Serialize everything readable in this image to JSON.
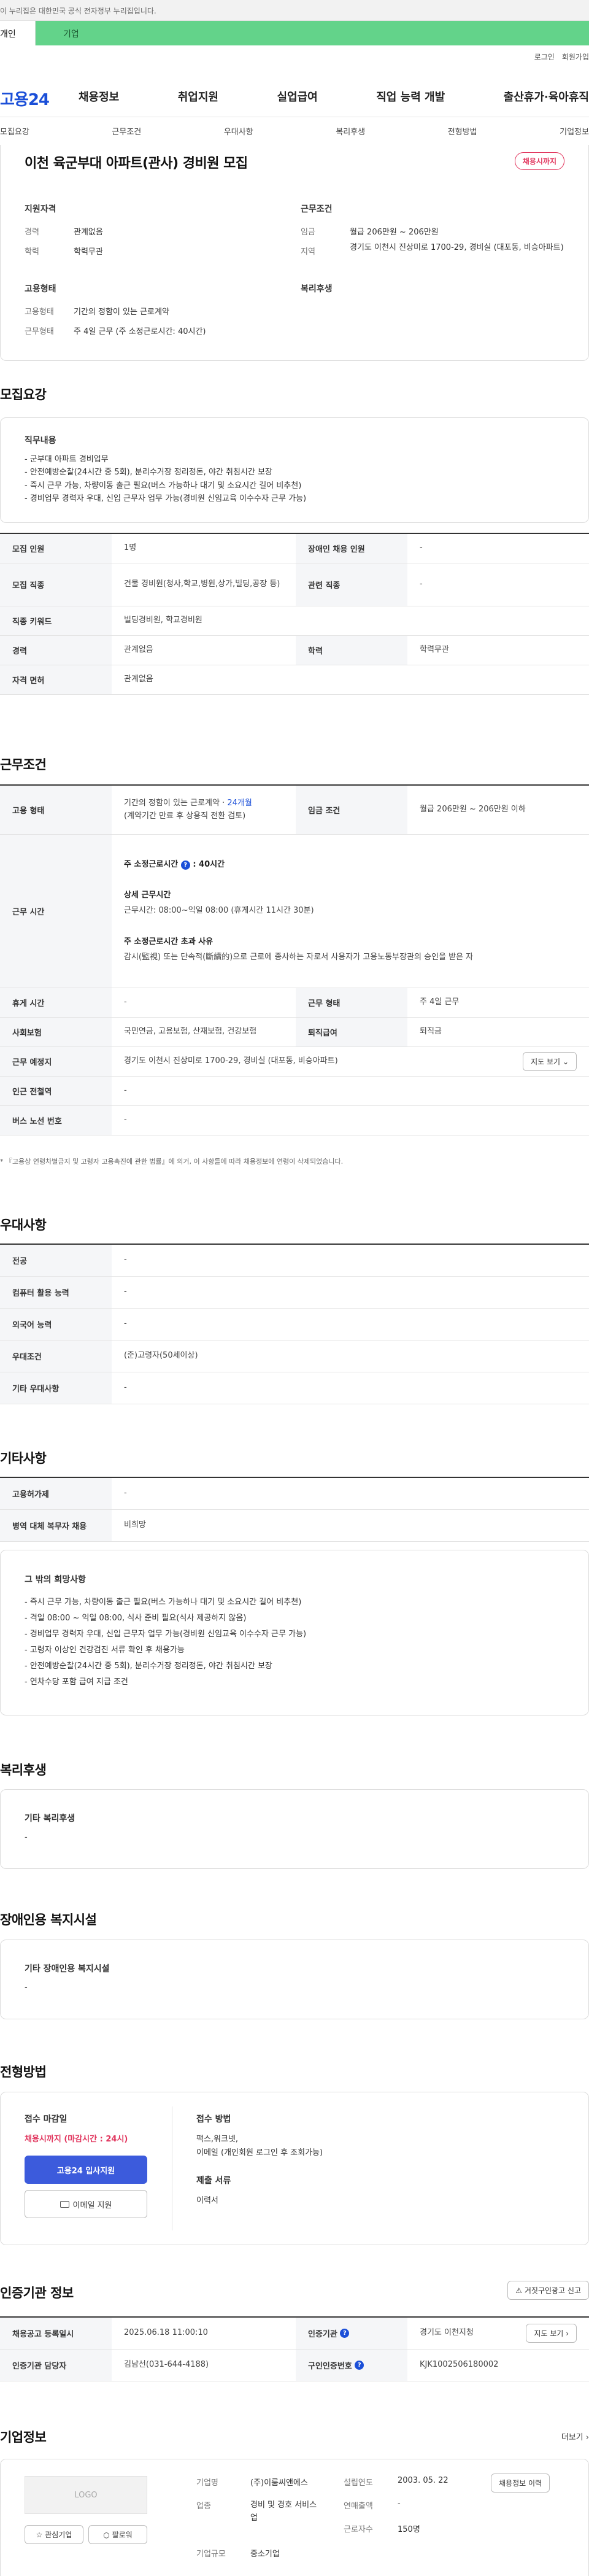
{
  "gov_notice": "이 누리집은 대한민국 공식 전자정부 누리집입니다.",
  "type_tabs": [
    "개인",
    "기업"
  ],
  "util_links": [
    "로그인",
    "회원가입"
  ],
  "logo": "고용24",
  "gnb": [
    "채용정보",
    "취업지원",
    "실업급여",
    "직업 능력 개발",
    "출산휴가·육아휴직"
  ],
  "subnav": [
    "모집요강",
    "근무조건",
    "우대사항",
    "복리후생",
    "전형방법",
    "기업정보"
  ],
  "job": {
    "title": "이천 육군부대 아파트(관사) 경비원 모집",
    "badge": "채용시까지"
  },
  "summary": {
    "qual_h": "지원자격",
    "career_l": "경력",
    "career_v": "관계없음",
    "edu_l": "학력",
    "edu_v": "학력무관",
    "cond_h": "근무조건",
    "wage_l": "임금",
    "wage_v": "월급 206만원 ~ 206만원",
    "loc_l": "지역",
    "loc_v": "경기도 이천시 진상미로 1700-29, 경비실 (대포동, 비승아파트)",
    "emp_h": "고용형태",
    "emp_l": "고용형태",
    "emp_v": "기간의 정함이 있는 근로계약",
    "work_l": "근무형태",
    "work_v": "주 4일 근무 (주 소정근로시간: 40시간)",
    "benefit_h": "복리후생"
  },
  "recruit": {
    "h2": "모집요강",
    "duty_h": "직무내용",
    "duty_lines": [
      "- 군부대 아파트 경비업무",
      "- 안전예방순찰(24시간 중 5회), 분리수거장 정리정돈, 야간 취침시간 보장",
      "- 즉시 근무 가능, 차량이동 출근 필요(버스 가능하나 대기 및 소요시간 길어 비추천)",
      "- 경비업무 경력자 우대, 신입 근무자 업무 가능(경비원 신임교육 이수수자 근무 가능)"
    ],
    "rows": [
      {
        "l1": "모집 인원",
        "v1": "1명",
        "l2": "장애인 채용 인원",
        "v2": "-"
      },
      {
        "l1": "모집 직종",
        "v1": "건물 경비원(청사,학교,병원,상가,빌딩,공장 등)",
        "l2": "관련 직종",
        "v2": "-"
      },
      {
        "l1": "직종 키워드",
        "v1": "빌딩경비원, 학교경비원"
      },
      {
        "l1": "경력",
        "v1": "관계없음",
        "l2": "학력",
        "v2": "학력무관"
      },
      {
        "l1": "자격 면허",
        "v1": "관계없음"
      }
    ]
  },
  "conditions": {
    "h2": "근무조건",
    "emp_l": "고용 형태",
    "emp_v": "기간의 정함이 있는 근로계약 · ",
    "emp_period": "24개월",
    "emp_note": "(계약기간 만료 후 상용직 전환 검토)",
    "wage_l": "임금 조건",
    "wage_v": "월급 206만원 ~ 206만원 이하",
    "time_l": "근무 시간",
    "time_week": "주 소정근로시간",
    "time_week_v": ": 40시간",
    "time_detail_h": "상세 근무시간",
    "time_detail_v": "근무시간: 08:00~익일 08:00 (휴게시간 11시간 30분)",
    "time_exceed_h": "주 소정근로시간 초과 사유",
    "time_exceed_v": "감시(監視) 또는 단속적(斷續的)으로 근로에 종사하는 자로서 사용자가 고용노동부장관의 승인을 받은 자",
    "rest_l": "휴게 시간",
    "rest_v": "-",
    "form_l": "근무 형태",
    "form_v": "주 4일 근무",
    "ins_l": "사회보험",
    "ins_v": "국민연금, 고용보험, 산재보험, 건강보험",
    "sev_l": "퇴직급여",
    "sev_v": "퇴직금",
    "place_l": "근무 예정지",
    "place_v": "경기도 이천시 진상미로 1700-29, 경비실 (대포동, 비승아파트)",
    "map_btn": "지도 보기",
    "subway_l": "인근 전철역",
    "subway_v": "-",
    "bus_l": "버스 노선 번호",
    "bus_v": "-",
    "footnote": "* 『고용상 연령차별금지 및 고령자 고용촉진에 관한 법률』에 의거, 이 사항들에 따라 채용정보에 연령이 삭제되었습니다."
  },
  "pref": {
    "h2": "우대사항",
    "rows": [
      {
        "l": "전공",
        "v": "-"
      },
      {
        "l": "컴퓨터 활용 능력",
        "v": "-"
      },
      {
        "l": "외국어 능력",
        "v": "-"
      },
      {
        "l": "우대조건",
        "v": "(준)고령자(50세이상)"
      },
      {
        "l": "기타 우대사항",
        "v": "-"
      }
    ]
  },
  "etc": {
    "h2": "기타사항",
    "rows": [
      {
        "l": "고용허가제",
        "v": "-"
      },
      {
        "l": "병역 대체 복무자 채용",
        "v": "비희망"
      }
    ],
    "box_h": "그 밖의 희망사항",
    "box_lines": [
      "- 즉시 근무 가능, 차량이동 출근 필요(버스 가능하나 대기 및 소요시간 길어 비추천)",
      "- 격일 08:00 ~ 익일 08:00, 식사 준비 필요(식사 제공하지 않음)",
      "- 경비업무 경력자 우대, 신입 근무자 업무 가능(경비원 신임교육 이수수자 근무 가능)",
      "- 고령자 이상인 건강검진 서류 확인 후 채용가능",
      "- 안전예방순찰(24시간 중 5회), 분리수거장 정리정돈, 야간 취침시간 보장",
      "- 연차수당 포함 급여 지급 조건"
    ]
  },
  "welfare": {
    "h2": "복리후생",
    "box_h": "기타 복리후생",
    "box_v": "-"
  },
  "disabled": {
    "h2": "장애인용 복지시설",
    "box_h": "기타 장애인용 복지시설",
    "box_v": "-"
  },
  "process": {
    "h2": "전형방법",
    "deadline_h": "접수 마감일",
    "deadline_v": "채용시까지 (마감시간 : 24시)",
    "apply_btn": "고용24 입사지원",
    "email_btn": "이메일 지원",
    "method_h": "접수 방법",
    "method_v1": "팩스,워크넷,",
    "method_v2": "이메일 (개인회원 로그인 후 조회가능)",
    "docs_h": "제출 서류",
    "docs_v": "이력서"
  },
  "agency": {
    "h2": "인증기관 정보",
    "report_btn": "거짓구인광고 신고",
    "reg_l": "채용공고 등록일시",
    "reg_v": "2025.06.18 11:00:10",
    "inst_l": "인증기관",
    "inst_v": "경기도 이천지청",
    "map_btn": "지도 보기",
    "staff_l": "인증기관 담당자",
    "staff_v": "김남선(031-644-4188)",
    "num_l": "구인인증번호",
    "num_v": "KJK1002506180002"
  },
  "company": {
    "h2": "기업정보",
    "more": "더보기",
    "logo_ph": "LOGO",
    "fav_btn": "관심기업",
    "follow_btn": "팔로워",
    "name_l": "기업명",
    "name_v": "(주)이룸씨앤에스",
    "est_l": "설립연도",
    "est_v": "2003. 05. 22",
    "jobs_btn": "채용정보 이력",
    "ind_l": "업종",
    "ind_v": "경비 및 경호 서비스업",
    "sales_l": "연매출액",
    "sales_v": "-",
    "emp_l": "근로자수",
    "emp_v": "150명",
    "type_l": "기업규모",
    "type_v": "중소기업"
  }
}
